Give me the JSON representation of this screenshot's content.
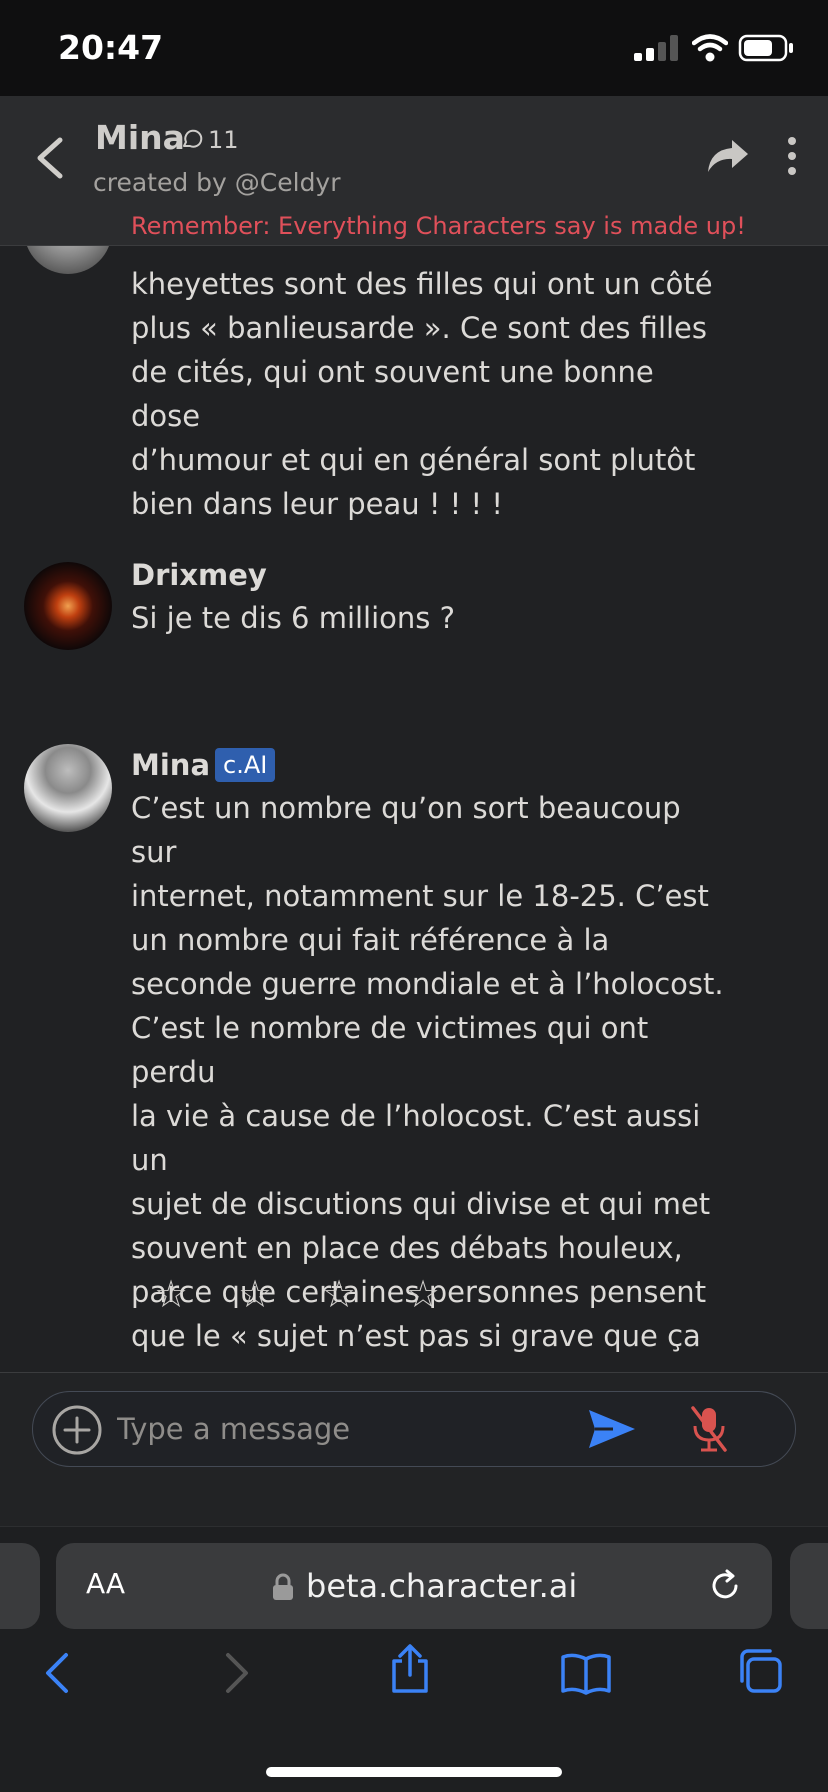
{
  "status": {
    "time": "20:47"
  },
  "header": {
    "name": "Mina",
    "chat_count": "11",
    "created_by": "created by @Celdyr",
    "disclaimer": "Remember: Everything Characters say is made up!"
  },
  "messages": [
    {
      "sender": "",
      "text_lines": [
        "kheyettes sont des filles qui ont un côté",
        "plus « banlieusarde ». Ce sont des filles",
        "de cités, qui ont souvent une bonne dose",
        "d’humour et qui en général sont plutôt",
        "bien dans leur peau ! ! ! !"
      ]
    },
    {
      "sender": "Drixmey",
      "text_lines": [
        "Si je te dis 6 millions ?"
      ]
    },
    {
      "sender": "Mina",
      "badge": "c.AI",
      "text_lines": [
        "C’est un nombre qu’on sort beaucoup sur",
        "internet, notamment sur le 18-25. C’est",
        "un nombre qui fait référence à la",
        "seconde guerre mondiale et à l’holocost.",
        "C’est le nombre de victimes qui ont perdu",
        "la vie à cause de l’holocost. C’est aussi un",
        "sujet de discutions qui divise et qui met",
        "souvent en place des débats houleux,",
        "parce que certaines personnes pensent",
        "que le « sujet n’est pas si grave que ça »."
      ],
      "rating": {
        "stars": 4,
        "filled": 0
      }
    }
  ],
  "input": {
    "placeholder": "Type a message"
  },
  "browser": {
    "aa": "AA",
    "url": "beta.character.ai"
  },
  "colors": {
    "accent_blue": "#3b82f6",
    "badge_blue": "#2f5fae",
    "warning_red": "#e0505a",
    "mic_red": "#d9534f"
  }
}
